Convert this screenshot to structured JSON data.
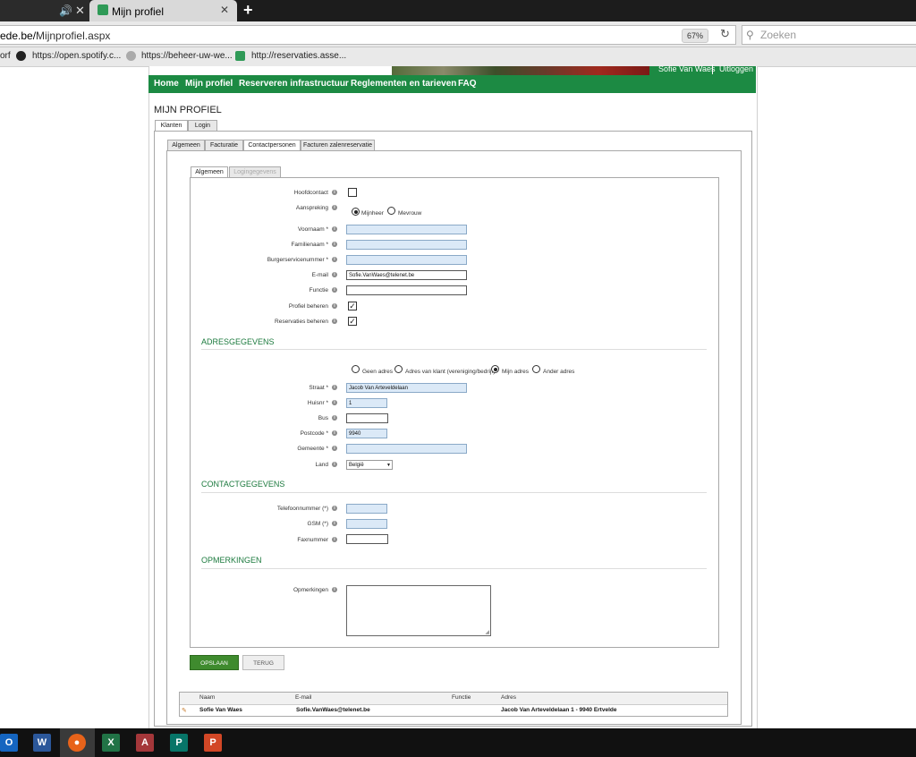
{
  "browser": {
    "tab_title": "Mijn profiel",
    "url_prefix": "ede.be/",
    "url_path": "Mijnprofiel.aspx",
    "zoom": "67%",
    "search_placeholder": "Zoeken",
    "bookmarks": [
      "orf",
      "https://open.spotify.c...",
      "https://beheer-uw-we...",
      "http://reservaties.asse..."
    ]
  },
  "header": {
    "user_name": "Sofie Van Waes",
    "logout": "Uitloggen",
    "nav": [
      "Home",
      "Mijn profiel",
      "Reserveren infrastructuur",
      "Reglementen en tarieven",
      "FAQ"
    ]
  },
  "page": {
    "title": "MIJN PROFIEL",
    "top_tabs": [
      "Klanten",
      "Login"
    ],
    "sub_tabs": [
      "Algemeen",
      "Facturatie",
      "Contactpersonen",
      "Facturen zalenreservatie"
    ],
    "inner_tabs": [
      "Algemeen",
      "Logingegevens"
    ]
  },
  "form": {
    "hoofdcontact_label": "Hoofdcontact",
    "aanspreking_label": "Aanspreking",
    "aanspreking_options": [
      "Mijnheer",
      "Mevrouw"
    ],
    "voornaam_label": "Voornaam *",
    "familienaam_label": "Familienaam *",
    "burgerservicenummer_label": "Burgerservicenummer *",
    "email_label": "E-mail",
    "email_value": "Sofie.VanWaes@telenet.be",
    "functie_label": "Functie",
    "profiel_beheren_label": "Profiel beheren",
    "reservaties_beheren_label": "Reservaties beheren",
    "section_adres": "ADRESGEGEVENS",
    "adres_options": [
      "Geen adres",
      "Adres van klant (vereniging/bedrijf)",
      "Mijn adres",
      "Ander adres"
    ],
    "straat_label": "Straat *",
    "straat_value": "Jacob Van Arteveldelaan",
    "huisnr_label": "Huisnr *",
    "huisnr_value": "1",
    "bus_label": "Bus",
    "postcode_label": "Postcode *",
    "postcode_value": "9940",
    "gemeente_label": "Gemeente *",
    "land_label": "Land",
    "land_value": "België",
    "section_contact": "CONTACTGEGEVENS",
    "telefoon_label": "Telefoonnummer (*)",
    "gsm_label": "GSM (*)",
    "fax_label": "Faxnummer",
    "section_opmerkingen": "OPMERKINGEN",
    "opmerkingen_label": "Opmerkingen",
    "save_label": "OPSLAAN",
    "back_label": "TERUG"
  },
  "grid": {
    "headers": [
      "Naam",
      "E-mail",
      "Functie",
      "Adres"
    ],
    "rows": [
      {
        "naam": "Sofie Van Waes",
        "email": "Sofie.VanWaes@telenet.be",
        "functie": "",
        "adres": "Jacob Van Arteveldelaan 1 - 9940 Ertvelde"
      }
    ]
  },
  "taskbar": [
    "outlook-icon",
    "word-icon",
    "firefox-icon",
    "excel-icon",
    "access-icon",
    "publisher-icon",
    "powerpoint-icon"
  ]
}
